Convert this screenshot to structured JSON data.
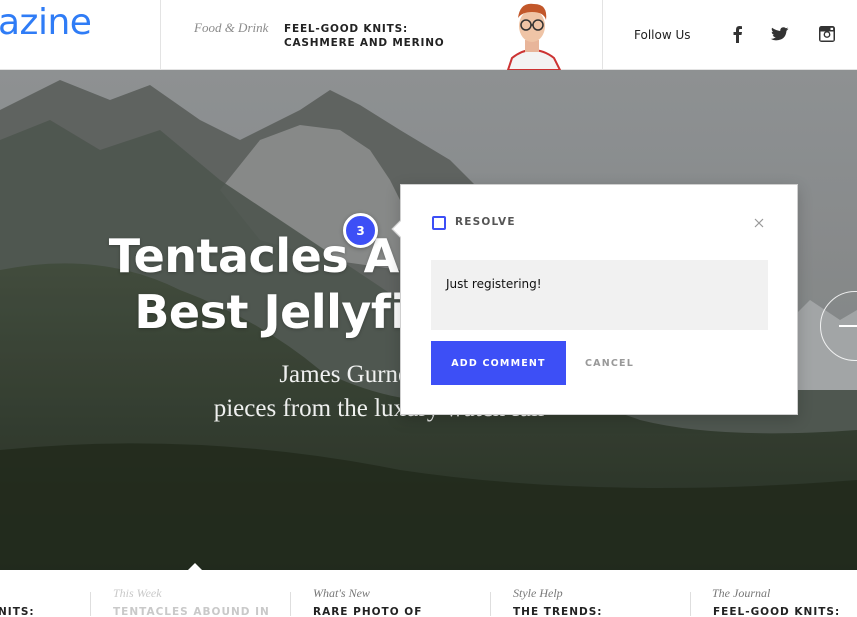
{
  "header": {
    "logo": "azine",
    "featured": {
      "category": "Food & Drink",
      "title_line1": "FEEL-GOOD KNITS:",
      "title_line2": "CASHMERE AND MERINO"
    },
    "follow_label": "Follow Us",
    "social": [
      "facebook-icon",
      "twitter-icon",
      "instagram-icon"
    ]
  },
  "hero": {
    "title_line1": "Tentacles Ab",
    "title_line2": "Best Jellyfi",
    "subtitle_line1": "James Gurney picks",
    "subtitle_line2": "pieces from the luxury watch fair"
  },
  "comment_marker": {
    "number": "3"
  },
  "comment_popup": {
    "resolve_label": "RESOLVE",
    "resolved": false,
    "comment_text": "Just registering!",
    "add_button": "ADD COMMENT",
    "cancel_button": "CANCEL"
  },
  "bottom_strip": {
    "items": [
      {
        "category": "",
        "title": "NITS:"
      },
      {
        "category": "This Week",
        "title": "TENTACLES ABOUND IN"
      },
      {
        "category": "What's New",
        "title": "RARE PHOTO OF"
      },
      {
        "category": "Style Help",
        "title": "THE TRENDS:"
      },
      {
        "category": "The Journal",
        "title": "FEEL-GOOD KNITS:"
      }
    ]
  },
  "colors": {
    "accent": "#3d4ff6",
    "logo": "#2f7cf6"
  }
}
